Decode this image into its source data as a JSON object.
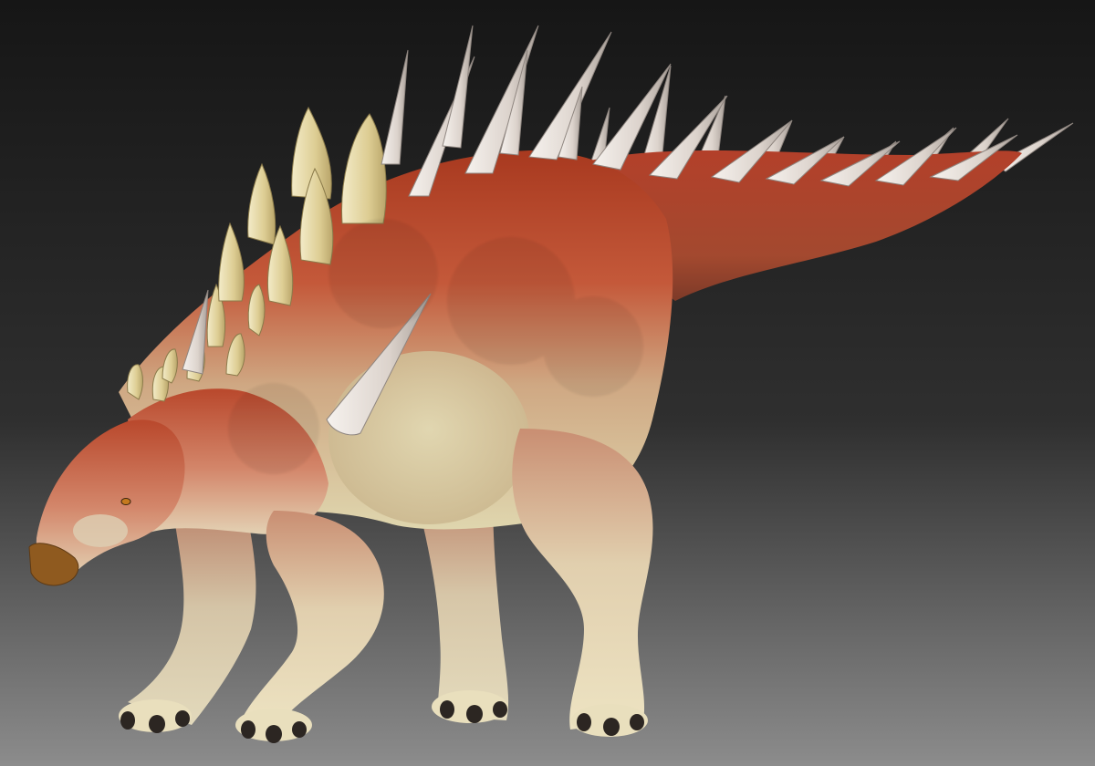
{
  "scene": {
    "subject": "stegosaur-sculpt",
    "background_top": "#1b1b1b",
    "background_bottom": "#8a8a8a",
    "skin_dorsal": "#b3412a",
    "skin_mid": "#c8643f",
    "skin_belly": "#cfc49a",
    "skin_pale": "#e6dcb8",
    "plate_color": "#e4d7a4",
    "spike_color": "#e9e2dc",
    "beak_color": "#8f5a1f",
    "claw_color": "#2c2622"
  }
}
